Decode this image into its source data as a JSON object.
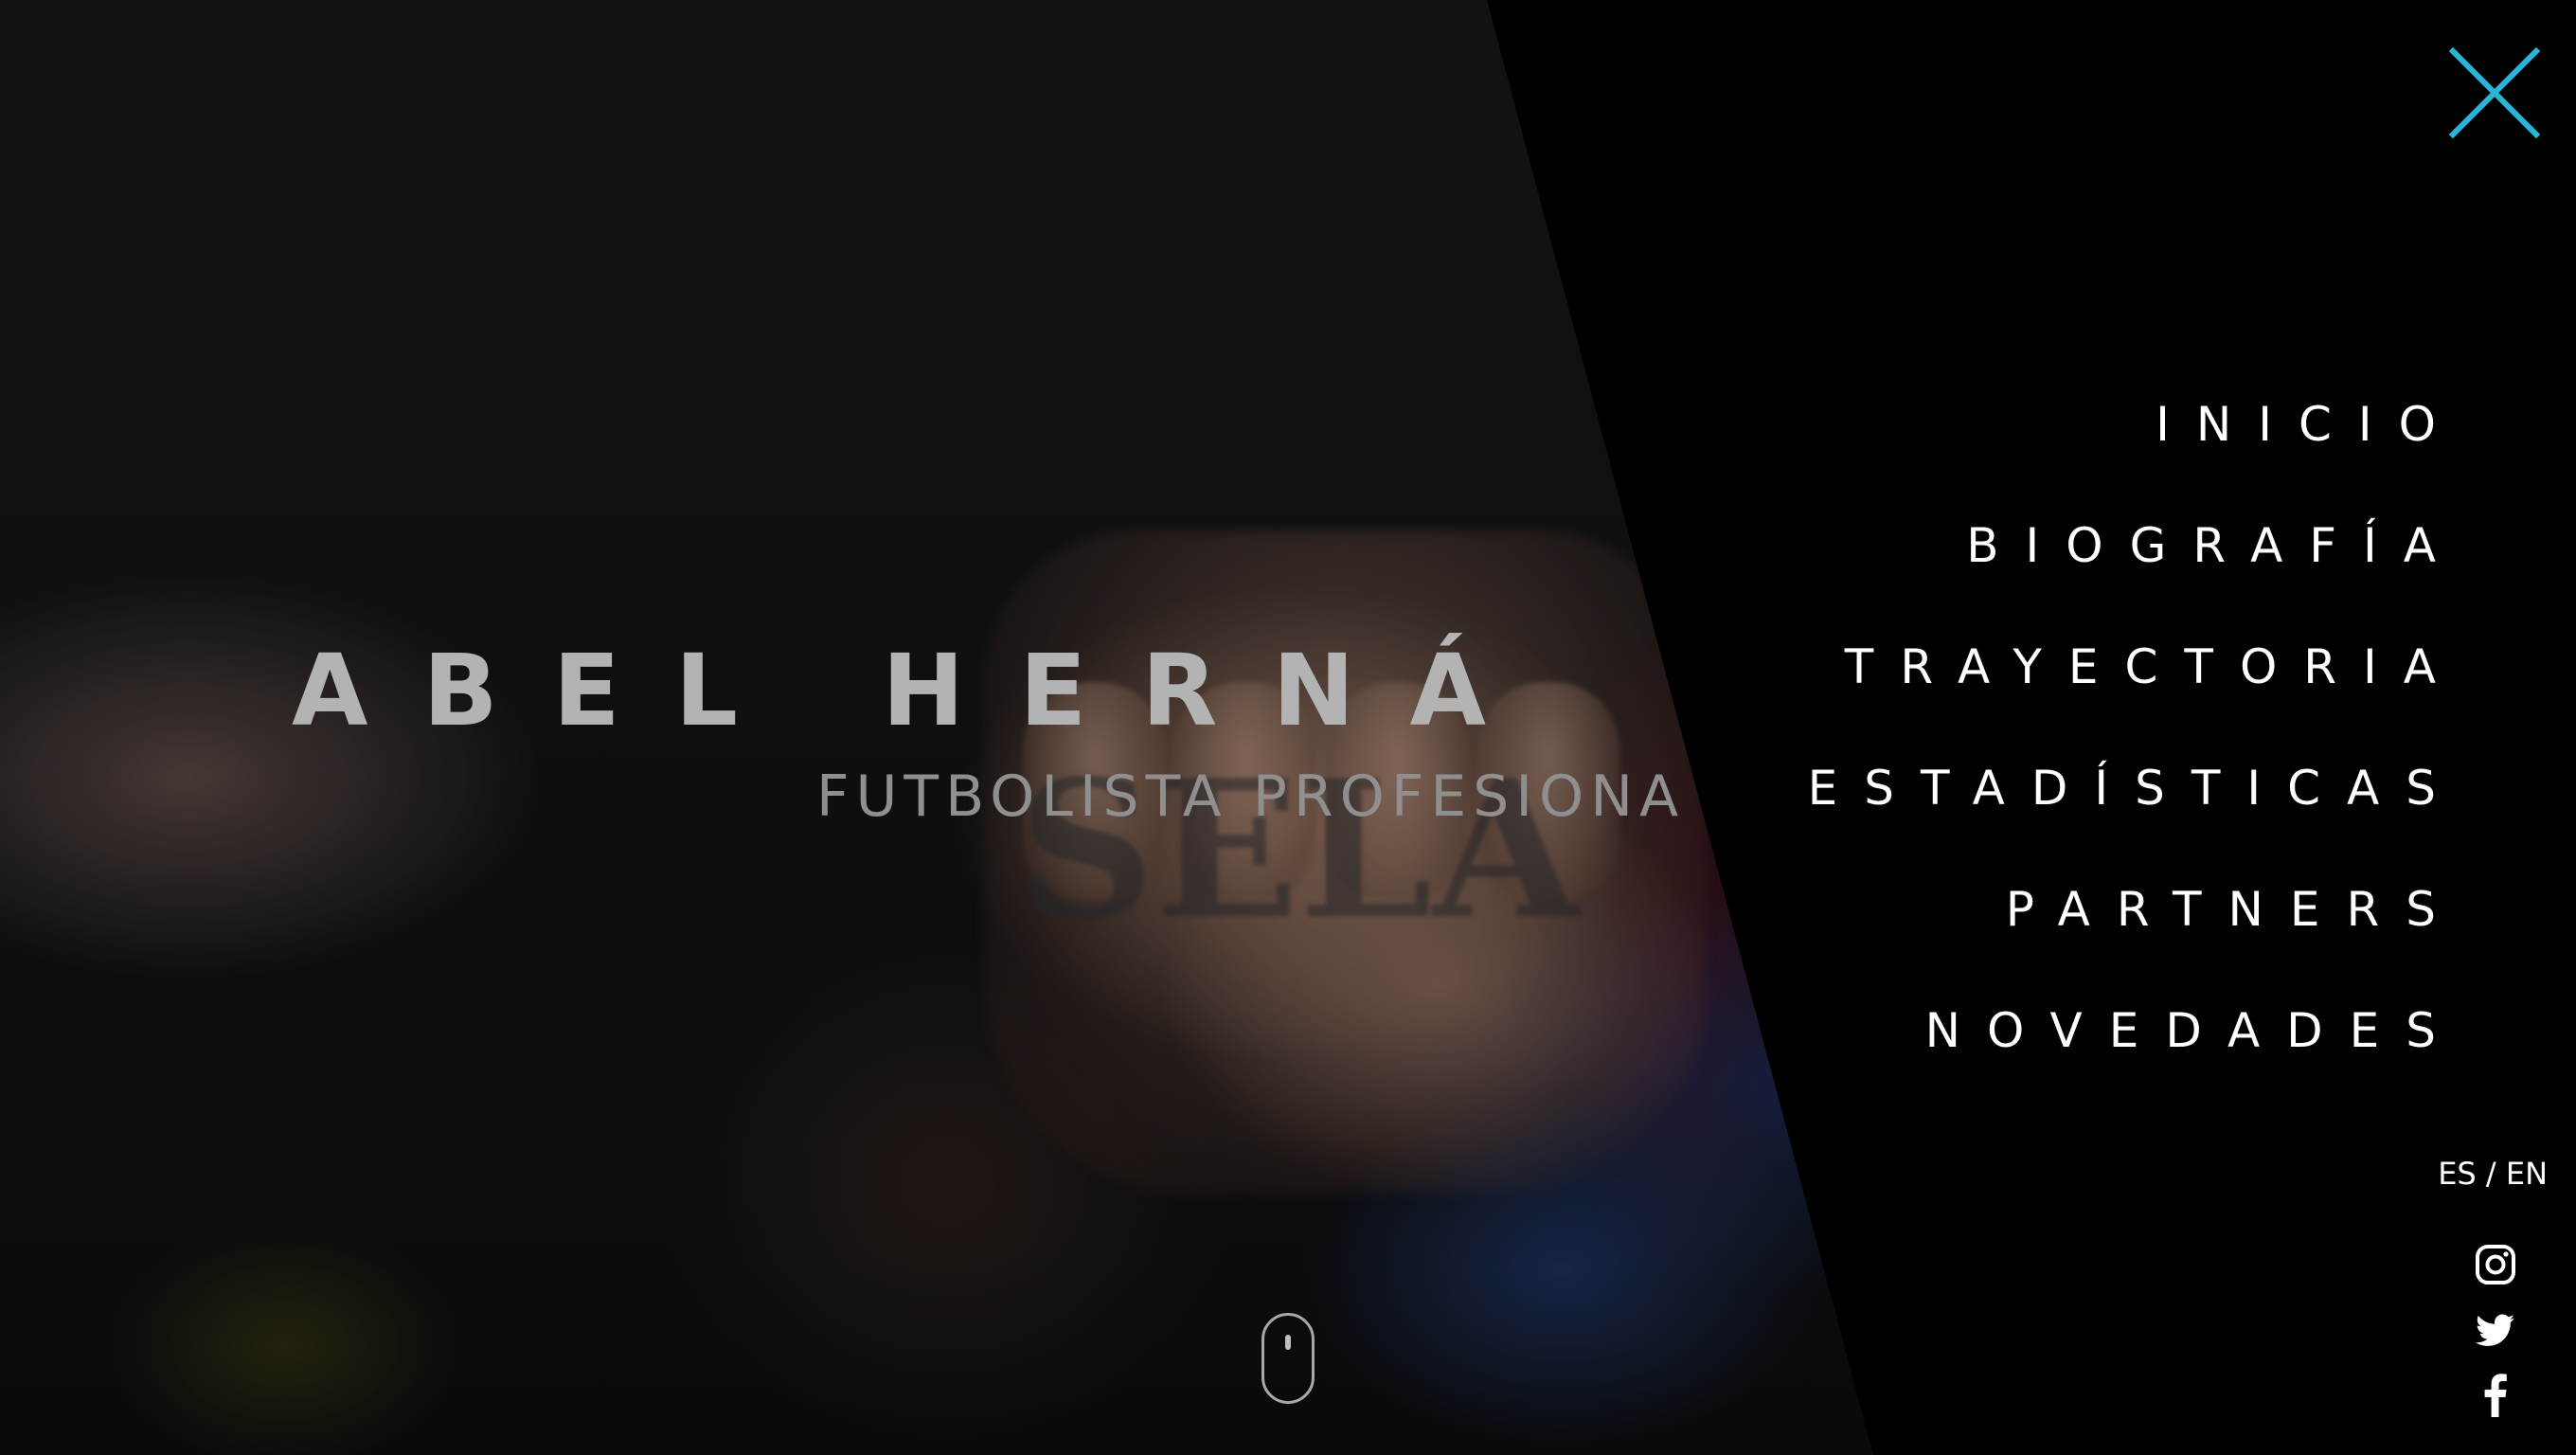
{
  "hero": {
    "title": "ABEL HERNÁ",
    "subtitle": "FUTBOLISTA PROFESIONA",
    "tattoo_letters": "SELA"
  },
  "menu": {
    "items": [
      {
        "label": "INICIO"
      },
      {
        "label": "BIOGRAFÍA"
      },
      {
        "label": "TRAYECTORIA"
      },
      {
        "label": "ESTADÍSTICAS"
      },
      {
        "label": "PARTNERS"
      },
      {
        "label": "NOVEDADES"
      }
    ]
  },
  "language": {
    "es": "ES",
    "separator": " / ",
    "en": "EN"
  },
  "social": {
    "icons": [
      "instagram-icon",
      "twitter-icon",
      "facebook-icon"
    ]
  },
  "colors": {
    "accent": "#29b6d6",
    "menu_text": "#ffffff",
    "panel_bg": "#000000"
  }
}
